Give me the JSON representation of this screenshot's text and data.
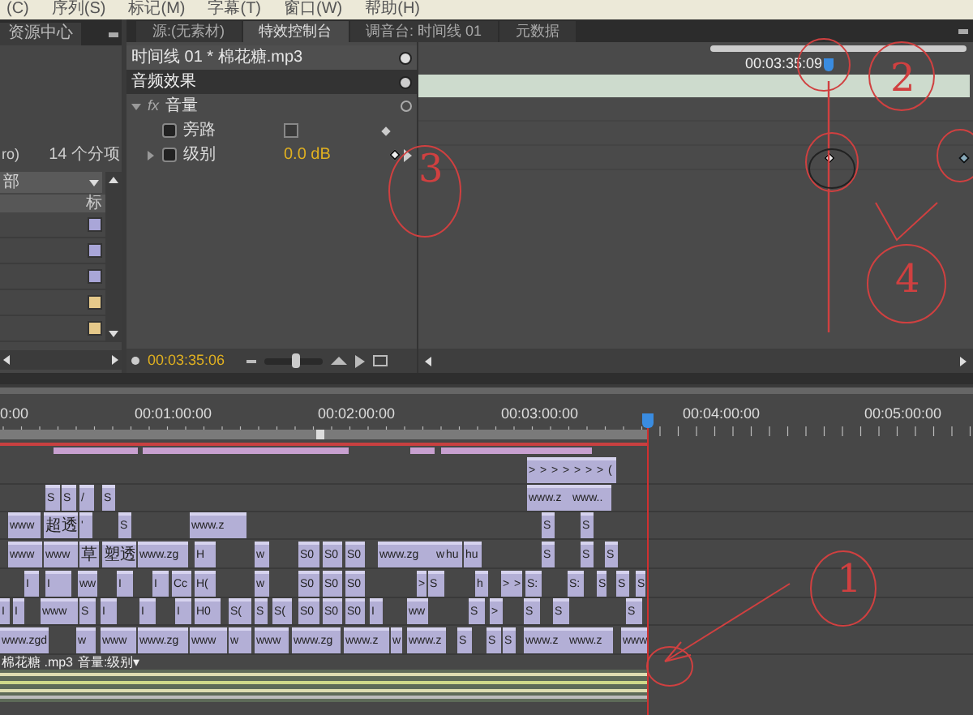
{
  "menu": [
    "(C)",
    "序列(S)",
    "标记(M)",
    "字幕(T)",
    "窗口(W)",
    "帮助(H)"
  ],
  "project_panel": {
    "tab": "资源中心",
    "info_left": "ro)",
    "count": "14 个分项",
    "filter": "部",
    "column": "标",
    "items": [
      {
        "color": "#a9a6d8"
      },
      {
        "color": "#a9a6d8"
      },
      {
        "color": "#a9a6d8"
      },
      {
        "color": "#e6c98a"
      },
      {
        "color": "#e6c98a"
      }
    ]
  },
  "tabs": [
    {
      "label": "源:(无素材)",
      "selected": false
    },
    {
      "label": "特效控制台",
      "selected": true
    },
    {
      "label": "调音台: 时间线 01",
      "selected": false
    },
    {
      "label": "元数据",
      "selected": false
    }
  ],
  "effect_controls": {
    "clip": "时间线 01 * 棉花糖.mp3",
    "section": "音频效果",
    "effect": {
      "fx": "fx",
      "name": "音量",
      "expanded": true,
      "params": [
        {
          "kind": "checkbox",
          "name": "旁路",
          "checked": false
        },
        {
          "kind": "value",
          "name": "级别",
          "value": "0.0 dB",
          "expanded": false
        }
      ]
    },
    "playhead_time": "00:03:35:09",
    "current_time": "00:03:35:06",
    "zoom": {
      "level": 0.55
    }
  },
  "timeline": {
    "ruler": [
      "0:00",
      "00:01:00:00",
      "00:02:00:00",
      "00:03:00:00",
      "00:04:00:00",
      "00:05:00:00"
    ],
    "tracks": [
      {
        "clips": [
          {
            "label": ">"
          },
          {
            "label": ">"
          },
          {
            "label": ">"
          },
          {
            "label": ">"
          },
          {
            "label": ">"
          },
          {
            "label": ">"
          },
          {
            "label": ">"
          },
          {
            "label": "("
          }
        ]
      },
      {
        "clips": [
          {
            "label": "S"
          },
          {
            "label": "S"
          },
          {
            "label": "/"
          },
          {
            "label": "S"
          },
          {
            "label": "www.z"
          },
          {
            "label": "www.."
          }
        ]
      },
      {
        "clips": [
          {
            "label": "www"
          },
          {
            "label": "超透"
          },
          {
            "label": "'"
          },
          {
            "label": "S"
          },
          {
            "label": "www.z"
          },
          {
            "label": "S"
          },
          {
            "label": "S"
          }
        ]
      },
      {
        "clips": [
          {
            "label": "www"
          },
          {
            "label": "www"
          },
          {
            "label": "草"
          },
          {
            "label": "塑透"
          },
          {
            "label": "www.zg"
          },
          {
            "label": "H"
          },
          {
            "label": "w"
          },
          {
            "label": "S0"
          },
          {
            "label": "S0"
          },
          {
            "label": "S0"
          },
          {
            "label": "www.zg"
          },
          {
            "label": "w"
          },
          {
            "label": "hu"
          },
          {
            "label": "hu"
          },
          {
            "label": "S"
          },
          {
            "label": "S"
          },
          {
            "label": "S"
          }
        ]
      },
      {
        "clips": [
          {
            "label": "I"
          },
          {
            "label": "I"
          },
          {
            "label": "ww"
          },
          {
            "label": "I"
          },
          {
            "label": "I"
          },
          {
            "label": "Cc"
          },
          {
            "label": "H("
          },
          {
            "label": "w"
          },
          {
            "label": "S0"
          },
          {
            "label": "S0"
          },
          {
            "label": "S0"
          },
          {
            "label": ">"
          },
          {
            "label": "S"
          },
          {
            "label": "h"
          },
          {
            "label": ">"
          },
          {
            "label": ">"
          },
          {
            "label": "S:"
          },
          {
            "label": "S:"
          },
          {
            "label": "S"
          },
          {
            "label": "S"
          },
          {
            "label": "S"
          }
        ]
      },
      {
        "clips": [
          {
            "label": "I"
          },
          {
            "label": "I"
          },
          {
            "label": "www"
          },
          {
            "label": "S"
          },
          {
            "label": "I"
          },
          {
            "label": "I"
          },
          {
            "label": "I"
          },
          {
            "label": "H0"
          },
          {
            "label": "S("
          },
          {
            "label": "S"
          },
          {
            "label": "S("
          },
          {
            "label": "S0"
          },
          {
            "label": "S0"
          },
          {
            "label": "S0"
          },
          {
            "label": "I"
          },
          {
            "label": "ww"
          },
          {
            "label": "S"
          },
          {
            "label": ">"
          },
          {
            "label": "S"
          },
          {
            "label": "S"
          },
          {
            "label": "S"
          }
        ]
      },
      {
        "clips": [
          {
            "label": "www.zgd"
          },
          {
            "label": "w"
          },
          {
            "label": "www"
          },
          {
            "label": "www.zg"
          },
          {
            "label": "www"
          },
          {
            "label": "w"
          },
          {
            "label": "www"
          },
          {
            "label": "www.zg"
          },
          {
            "label": "www.z"
          },
          {
            "label": "w"
          },
          {
            "label": "www.z"
          },
          {
            "label": "S"
          },
          {
            "label": "S"
          },
          {
            "label": "S"
          },
          {
            "label": "www.z"
          },
          {
            "label": "www.z"
          },
          {
            "label": "www"
          }
        ]
      }
    ],
    "audio_track": {
      "label": "棉花糖 .mp3",
      "property": "音量:级别▾"
    }
  },
  "annotations": [
    {
      "label": "1"
    },
    {
      "label": "2"
    },
    {
      "label": "3"
    },
    {
      "label": "4"
    }
  ]
}
